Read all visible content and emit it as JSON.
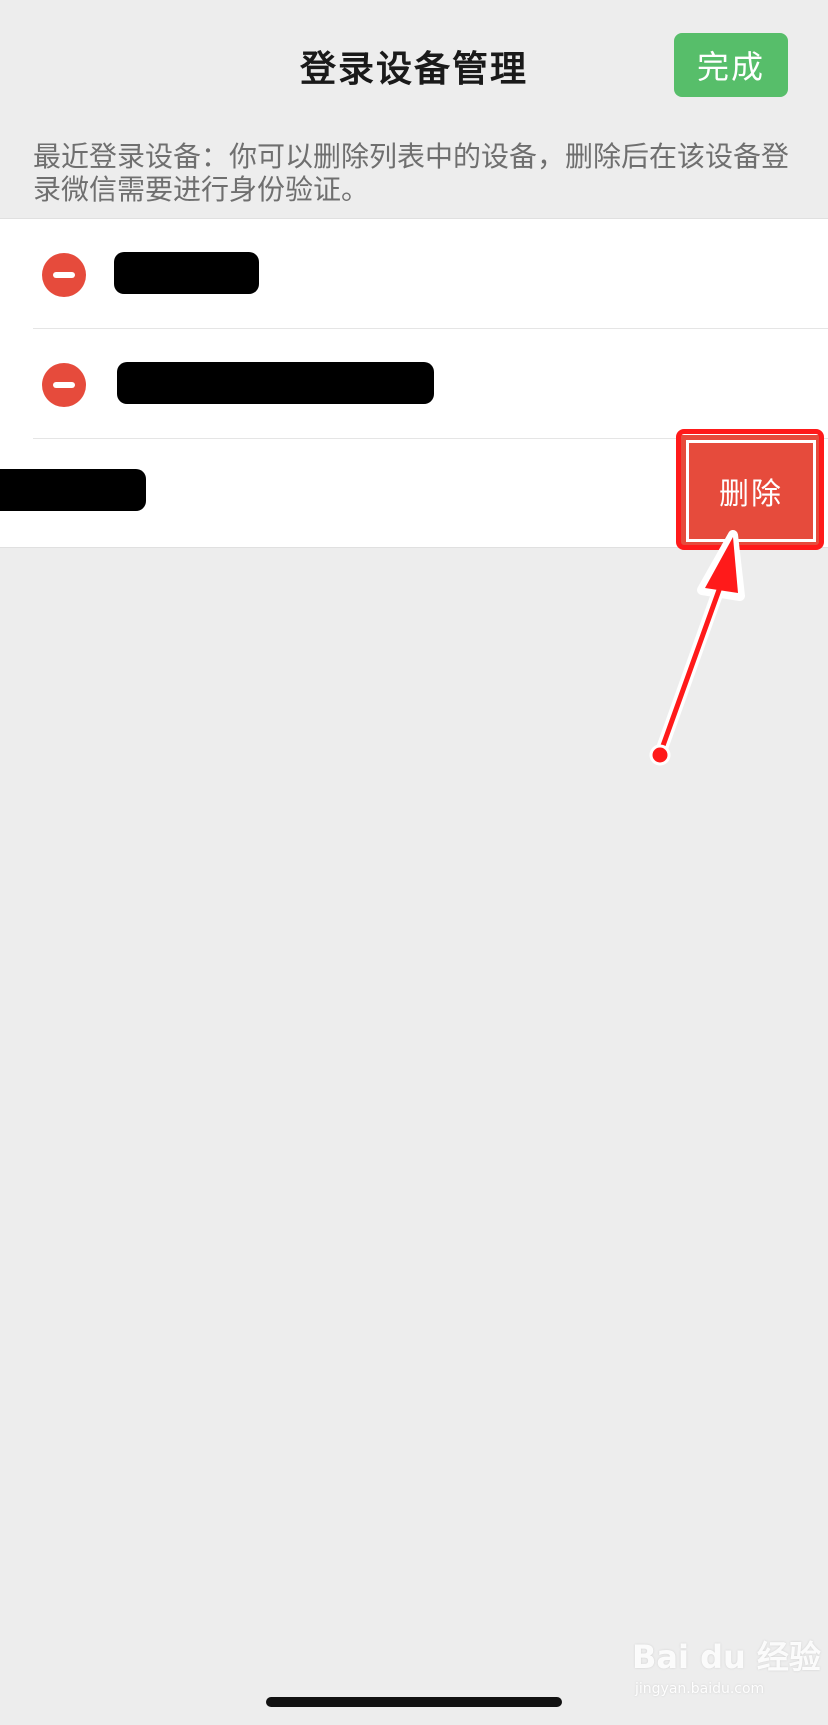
{
  "header": {
    "title": "登录设备管理",
    "done_label": "完成"
  },
  "description": "最近登录设备：你可以删除列表中的设备，删除后在该设备登录微信需要进行身份验证。",
  "devices": [
    {
      "state": "editing",
      "name": ""
    },
    {
      "state": "editing",
      "name": ""
    },
    {
      "state": "swiped",
      "name": "",
      "delete_label": "删除"
    }
  ],
  "watermark": {
    "brand": "Bai du 经验",
    "url": "jingyan.baidu.com"
  },
  "colors": {
    "background": "#ededed",
    "done_button": "#57be6a",
    "delete_button": "#e64b3c",
    "annotation": "#ff1a1a"
  },
  "icons": [
    "minus-circle-icon",
    "annotation-arrow-icon"
  ]
}
